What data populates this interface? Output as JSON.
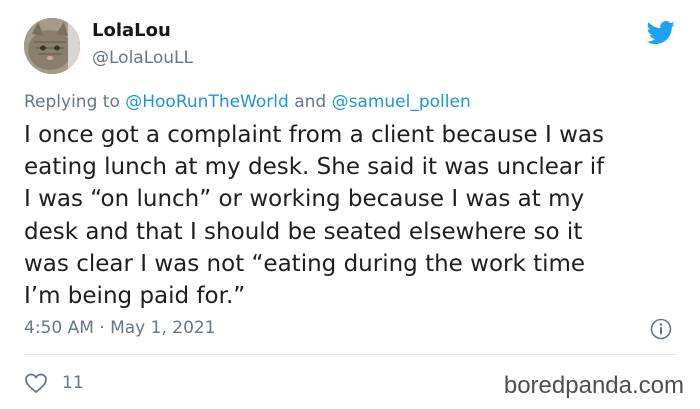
{
  "user": {
    "display_name": "LolaLou",
    "handle": "@LolaLouLL",
    "avatar_icon": "cat-avatar"
  },
  "reply_context": {
    "prefix": "Replying to",
    "mention1": "@HooRunTheWorld",
    "conjunction": "and",
    "mention2": "@samuel_pollen"
  },
  "tweet": {
    "lines": [
      "I once got a complaint from a client because I was",
      "eating lunch at my desk. She said it was unclear if",
      "I was “on lunch” or working because I was at my",
      "desk and that I should be seated elsewhere so it",
      "was clear I was not “eating during the work time",
      "I’m being paid for.”"
    ],
    "timestamp": "4:50 AM · May 1, 2021"
  },
  "actions": {
    "like_count": "11",
    "like_icon": "heart-icon",
    "info_icon": "info-icon"
  },
  "brand": {
    "logo_icon": "twitter-bird-icon",
    "watermark": "boredpanda.com"
  },
  "colors": {
    "twitter_blue": "#1da1f2",
    "mention_blue": "#1b95e0",
    "secondary_text": "#657786"
  }
}
